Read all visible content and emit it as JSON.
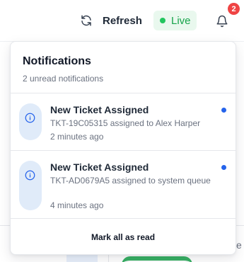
{
  "topbar": {
    "refresh_label": "Refresh",
    "live_label": "Live",
    "notification_count": "2",
    "icons": {
      "refresh": "refresh-icon",
      "live": "status-dot",
      "bell": "bell-icon"
    }
  },
  "notifications_panel": {
    "title": "Notifications",
    "subtitle": "2 unread notifications",
    "items": [
      {
        "title": "New Ticket Assigned",
        "description": "TKT-19C05315 assigned to Alex Harper",
        "time": "2 minutes ago",
        "unread": true,
        "icon": "info-icon"
      },
      {
        "title": "New Ticket Assigned",
        "description": "TKT-AD0679A5 assigned to system queue",
        "time": "4 minutes ago",
        "unread": true,
        "icon": "info-icon"
      }
    ],
    "mark_all_label": "Mark all as read"
  },
  "colors": {
    "accent": "#2563eb",
    "live": "#16a34a",
    "badge": "#ef4444",
    "icon_bg": "#e0ebf9"
  }
}
